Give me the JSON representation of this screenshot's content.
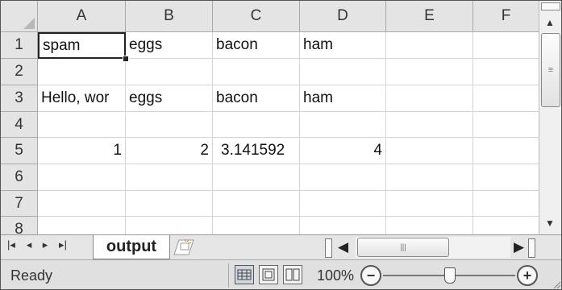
{
  "columns": [
    "A",
    "B",
    "C",
    "D",
    "E",
    "F"
  ],
  "rows": [
    "1",
    "2",
    "3",
    "4",
    "5",
    "6",
    "7",
    "8"
  ],
  "cells": {
    "A1": "spam",
    "B1": "eggs",
    "C1": "bacon",
    "D1": "ham",
    "A3": "Hello, wor",
    "B3": "eggs",
    "C3": "bacon",
    "D3": "ham",
    "A5": "1",
    "B5": "2",
    "C5": "3.141592",
    "D5": "4"
  },
  "selected_cell": "A1",
  "sheet_tab": {
    "label": "output"
  },
  "status": {
    "ready": "Ready",
    "zoom": "100%"
  },
  "zoom_level": 0.5,
  "icons": {
    "vscroll_up": "up-arrow-icon",
    "vscroll_down": "down-arrow-icon",
    "first_sheet": "first-sheet-icon",
    "prev_sheet": "prev-sheet-icon",
    "next_sheet": "next-sheet-icon",
    "last_sheet": "last-sheet-icon",
    "insert_sheet": "insert-sheet-icon",
    "zoom_out": "zoom-out-icon",
    "zoom_in": "zoom-in-icon"
  }
}
